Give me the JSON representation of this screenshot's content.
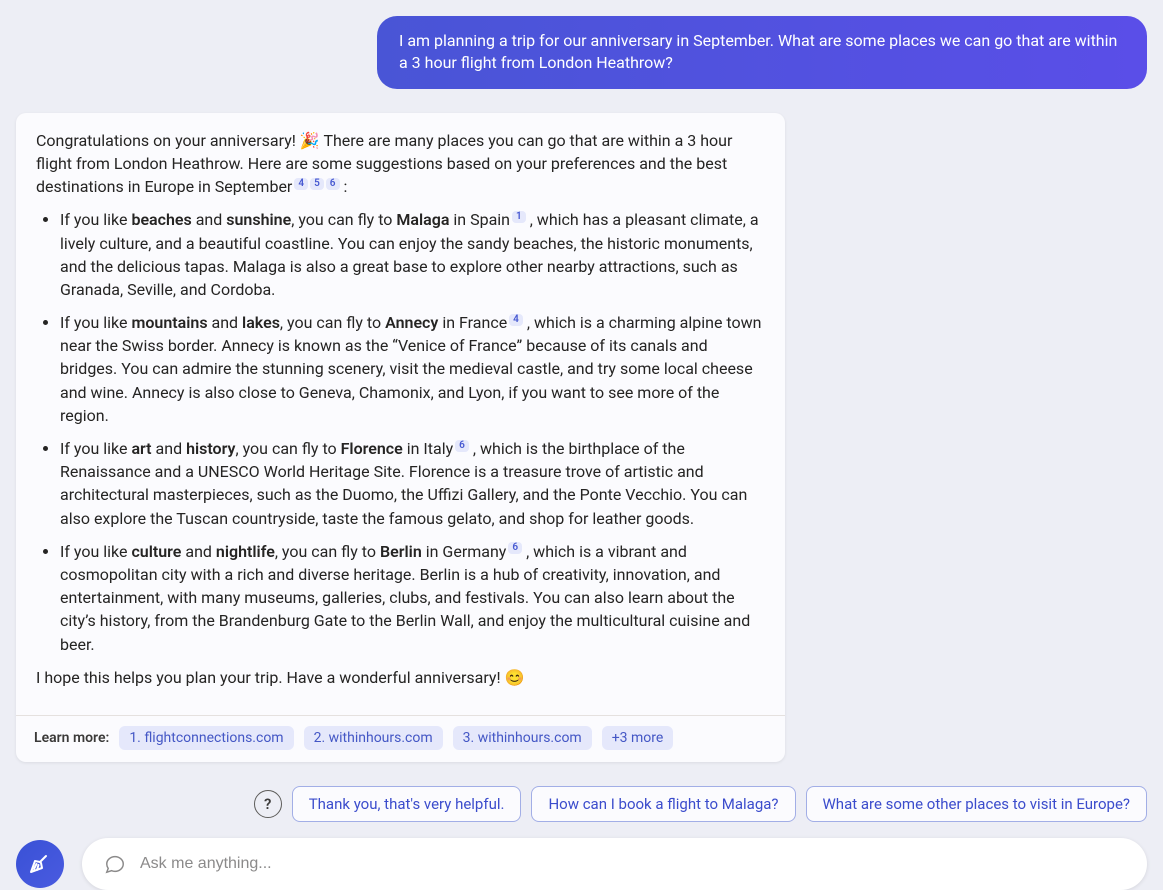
{
  "user_message": "I am planning a trip for our anniversary in September. What are some places we can go that are within a 3 hour flight from London Heathrow?",
  "assistant": {
    "intro_before_refs": "Congratulations on your anniversary! 🎉 There are many places you can go that are within a 3 hour flight from London Heathrow. Here are some suggestions based on your preferences and the best destinations in Europe in September",
    "intro_refs": [
      "4",
      "5",
      "6"
    ],
    "intro_after_refs": " :",
    "bullets": [
      {
        "pre": "If you like ",
        "bold1": "beaches",
        "mid1": " and ",
        "bold2": "sunshine",
        "mid2": ", you can fly to ",
        "bold3": "Malaga",
        "mid3": " in Spain",
        "ref": "1",
        "post": " , which has a pleasant climate, a lively culture, and a beautiful coastline. You can enjoy the sandy beaches, the historic monuments, and the delicious tapas. Malaga is also a great base to explore other nearby attractions, such as Granada, Seville, and Cordoba."
      },
      {
        "pre": "If you like ",
        "bold1": "mountains",
        "mid1": " and ",
        "bold2": "lakes",
        "mid2": ", you can fly to ",
        "bold3": "Annecy",
        "mid3": " in France",
        "ref": "4",
        "post": " , which is a charming alpine town near the Swiss border. Annecy is known as the “Venice of France” because of its canals and bridges. You can admire the stunning scenery, visit the medieval castle, and try some local cheese and wine. Annecy is also close to Geneva, Chamonix, and Lyon, if you want to see more of the region."
      },
      {
        "pre": "If you like ",
        "bold1": "art",
        "mid1": " and ",
        "bold2": "history",
        "mid2": ", you can fly to ",
        "bold3": "Florence",
        "mid3": " in Italy",
        "ref": "6",
        "post": " , which is the birthplace of the Renaissance and a UNESCO World Heritage Site. Florence is a treasure trove of artistic and architectural masterpieces, such as the Duomo, the Uffizi Gallery, and the Ponte Vecchio. You can also explore the Tuscan countryside, taste the famous gelato, and shop for leather goods."
      },
      {
        "pre": "If you like ",
        "bold1": "culture",
        "mid1": " and ",
        "bold2": "nightlife",
        "mid2": ", you can fly to ",
        "bold3": "Berlin",
        "mid3": " in Germany",
        "ref": "6",
        "post": " , which is a vibrant and cosmopolitan city with a rich and diverse heritage. Berlin is a hub of creativity, innovation, and entertainment, with many museums, galleries, clubs, and festivals. You can also learn about the city’s history, from the Brandenburg Gate to the Berlin Wall, and enjoy the multicultural cuisine and beer."
      }
    ],
    "outro": "I hope this helps you plan your trip. Have a wonderful anniversary! 😊"
  },
  "learn_more": {
    "label": "Learn more:",
    "chips": [
      "1. flightconnections.com",
      "2. withinhours.com",
      "3. withinhours.com",
      "+3 more"
    ]
  },
  "suggestions": [
    "Thank you, that's very helpful.",
    "How can I book a flight to Malaga?",
    "What are some other places to visit in Europe?"
  ],
  "input": {
    "placeholder": "Ask me anything..."
  },
  "help_icon_glyph": "?"
}
